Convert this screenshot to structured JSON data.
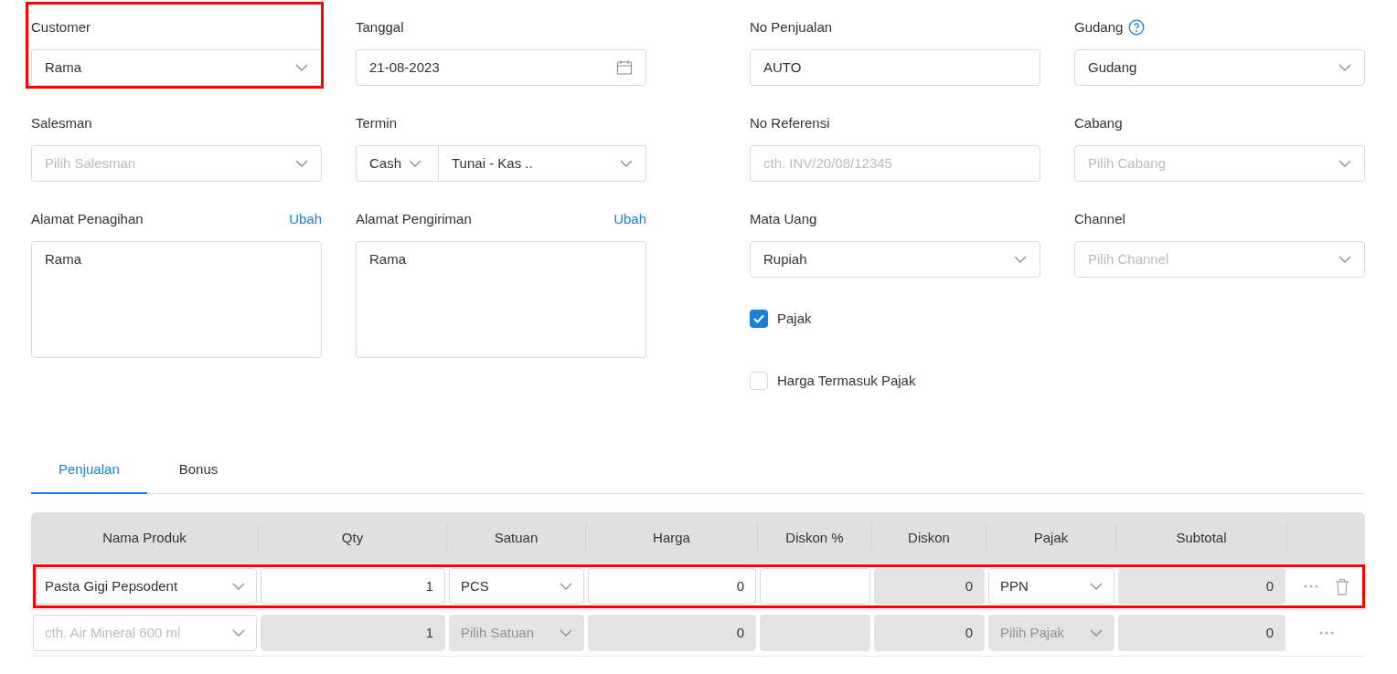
{
  "form_columns": [
    [
      {
        "kind": "select",
        "label": "Customer",
        "value": "Rama",
        "highlighted": true
      },
      {
        "kind": "select",
        "label": "Salesman",
        "placeholder": "Pilih Salesman",
        "highlighted": false
      },
      {
        "kind": "textarea",
        "label": "Alamat Penagihan",
        "link": "Ubah",
        "value": "Rama"
      }
    ],
    [
      {
        "kind": "date",
        "label": "Tanggal",
        "value": "21-08-2023"
      },
      {
        "kind": "termin",
        "label": "Termin",
        "value": "Cash",
        "value_2": "Tunai - Kas .."
      },
      {
        "kind": "textarea",
        "label": "Alamat Pengiriman",
        "link": "Ubah",
        "value": "Rama"
      }
    ],
    [
      {
        "kind": "text",
        "label": "No Penjualan",
        "value": "AUTO"
      },
      {
        "kind": "text",
        "label": "No Referensi",
        "placeholder": "cth. INV/20/08/12345"
      },
      {
        "kind": "select",
        "label": "Mata Uang",
        "value": "Rupiah",
        "highlighted": false
      },
      {
        "kind": "checkbox",
        "label": "Pajak",
        "checked": true
      },
      {
        "kind": "checkbox",
        "label": "Harga Termasuk Pajak",
        "checked": false
      }
    ],
    [
      {
        "kind": "select",
        "label": "Gudang",
        "help": true,
        "value": "Gudang",
        "highlighted": false
      },
      {
        "kind": "select",
        "label": "Cabang",
        "placeholder": "Pilih Cabang",
        "highlighted": false
      },
      {
        "kind": "select",
        "label": "Channel",
        "placeholder": "Pilih Channel",
        "highlighted": false
      }
    ]
  ],
  "tabs": [
    {
      "label": "Penjualan",
      "selected": true
    },
    {
      "label": "Bonus",
      "selected": false
    }
  ],
  "table": {
    "columns": [
      "Nama Produk",
      "Qty",
      "Satuan",
      "Harga",
      "Diskon %",
      "Diskon",
      "Pajak",
      "Subtotal"
    ],
    "rows": [
      {
        "highlighted": true,
        "deletable": true,
        "cells": [
          {
            "kind": "select",
            "value": "Pasta Gigi Pepsodent",
            "disabled": false
          },
          {
            "kind": "number",
            "value": "1",
            "disabled": false
          },
          {
            "kind": "select",
            "value": "PCS",
            "disabled": false
          },
          {
            "kind": "number",
            "value": "0",
            "disabled": false
          },
          {
            "kind": "number",
            "disabled": false
          },
          {
            "kind": "number",
            "value": "0",
            "disabled": true
          },
          {
            "kind": "select",
            "value": "PPN",
            "disabled": false
          },
          {
            "kind": "number",
            "value": "0",
            "disabled": true
          }
        ]
      },
      {
        "highlighted": false,
        "deletable": false,
        "cells": [
          {
            "kind": "select",
            "placeholder": "cth. Air Mineral 600 ml",
            "disabled": false
          },
          {
            "kind": "number",
            "value": "1",
            "disabled": true
          },
          {
            "kind": "select",
            "placeholder": "Pilih Satuan",
            "disabled": true
          },
          {
            "kind": "number",
            "value": "0",
            "disabled": true
          },
          {
            "kind": "number",
            "disabled": true
          },
          {
            "kind": "number",
            "value": "0",
            "disabled": true
          },
          {
            "kind": "select",
            "placeholder": "Pilih Pajak",
            "disabled": true
          },
          {
            "kind": "number",
            "value": "0",
            "disabled": true
          }
        ]
      }
    ]
  }
}
